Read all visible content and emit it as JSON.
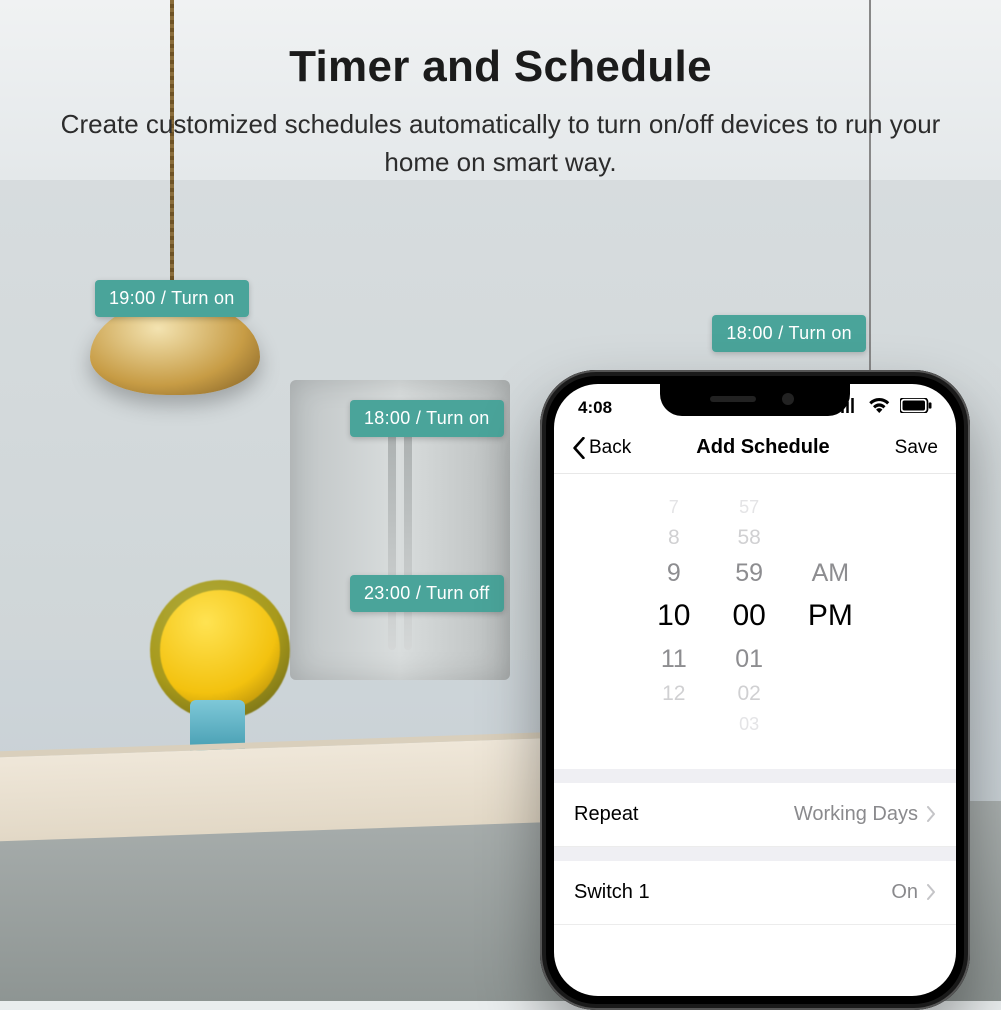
{
  "headline": {
    "title": "Timer and Schedule",
    "subtitle": "Create customized schedules automatically to turn on/off devices to run your home on smart way."
  },
  "tags": {
    "lamp": "19:00 / Turn on",
    "fridge": "18:00 / Turn on",
    "oven": "23:00 / Turn off",
    "ceiling": "18:00 / Turn on"
  },
  "phone": {
    "status_time": "4:08",
    "nav": {
      "back": "Back",
      "title": "Add Schedule",
      "save": "Save"
    },
    "picker": {
      "hours": [
        "7",
        "8",
        "9",
        "10",
        "11",
        "12"
      ],
      "minutes": [
        "57",
        "58",
        "59",
        "00",
        "01",
        "02",
        "03"
      ],
      "period": [
        "AM",
        "PM"
      ],
      "selected": {
        "hour": "10",
        "minute": "00",
        "period": "PM"
      }
    },
    "rows": {
      "repeat": {
        "label": "Repeat",
        "value": "Working Days"
      },
      "switch": {
        "label": "Switch 1",
        "value": "On"
      }
    }
  }
}
